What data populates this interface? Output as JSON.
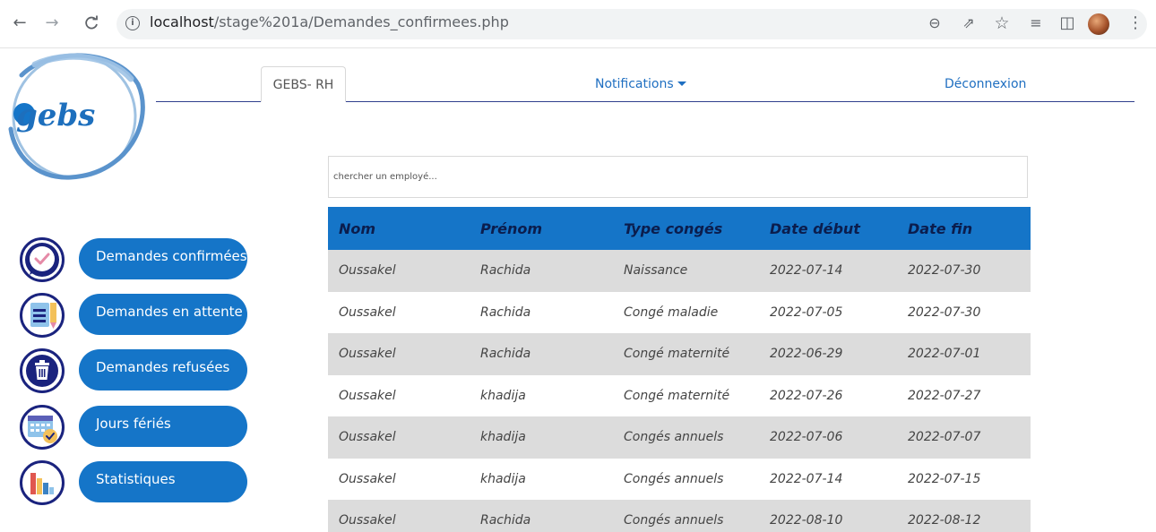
{
  "browser": {
    "url_host": "localhost",
    "url_path": "/stage%201a/Demandes_confirmees.php",
    "back_glyph": "←",
    "forward_glyph": "→",
    "reload_glyph": "C",
    "info_glyph": "i",
    "zoom_glyph": "⊖",
    "share_glyph": "⇗",
    "star_glyph": "☆",
    "reading_glyph": "≡",
    "sidepanel_glyph": "◫",
    "menu_glyph": "⋮"
  },
  "logo": {
    "text": "gebs"
  },
  "nav": {
    "brand_tab": "GEBS- RH",
    "notifications": "Notifications",
    "logout": "Déconnexion"
  },
  "sidebar": {
    "items": [
      {
        "label": "Demandes confirmées",
        "icon": "confirmed-chat-icon"
      },
      {
        "label": "Demandes en attente",
        "icon": "pending-document-icon"
      },
      {
        "label": "Demandes refusées",
        "icon": "trash-icon"
      },
      {
        "label": "Jours fériés",
        "icon": "calendar-check-icon"
      },
      {
        "label": "Statistiques",
        "icon": "bar-chart-icon"
      }
    ]
  },
  "search": {
    "placeholder": "chercher un employé..."
  },
  "table": {
    "headers": [
      "Nom",
      "Prénom",
      "Type congés",
      "Date début",
      "Date fin"
    ],
    "rows": [
      [
        "Oussakel",
        "Rachida",
        "Naissance",
        "2022-07-14",
        "2022-07-30"
      ],
      [
        "Oussakel",
        "Rachida",
        "Congé maladie",
        "2022-07-05",
        "2022-07-30"
      ],
      [
        "Oussakel",
        "Rachida",
        "Congé maternité",
        "2022-06-29",
        "2022-07-01"
      ],
      [
        "Oussakel",
        "khadija",
        "Congé maternité",
        "2022-07-26",
        "2022-07-27"
      ],
      [
        "Oussakel",
        "khadija",
        "Congés annuels",
        "2022-07-06",
        "2022-07-07"
      ],
      [
        "Oussakel",
        "khadija",
        "Congés annuels",
        "2022-07-14",
        "2022-07-15"
      ],
      [
        "Oussakel",
        "Rachida",
        "Congés annuels",
        "2022-08-10",
        "2022-08-12"
      ]
    ]
  },
  "colors": {
    "accent": "#1575c8",
    "header_text": "#0b1d4d",
    "row_alt": "#dcdcdc",
    "nav_line": "#2f3f8c",
    "link": "#1f6fc1"
  }
}
